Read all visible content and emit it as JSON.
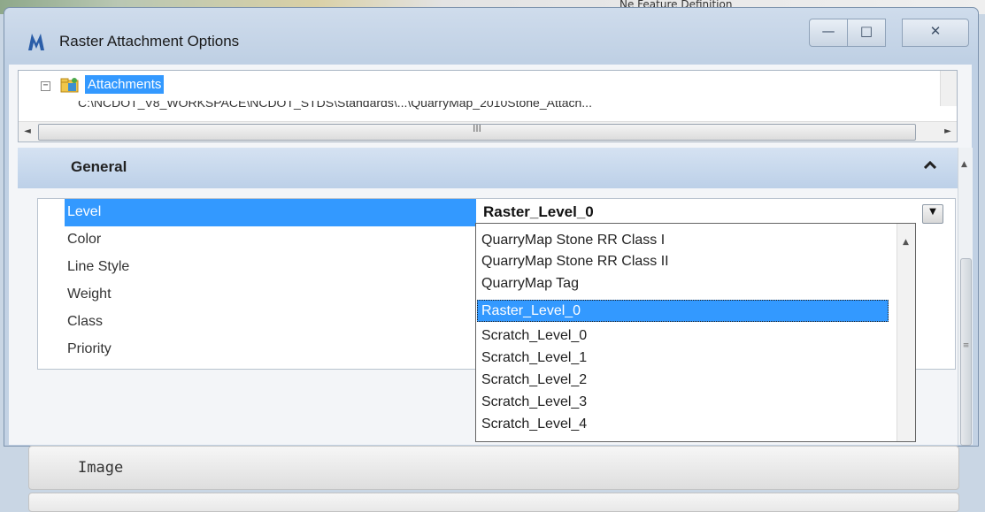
{
  "window": {
    "title": "Raster Attachment Options",
    "background_title": "Ne Feature Definition"
  },
  "caption_buttons": {
    "minimize": "—",
    "maximize": "□",
    "close": "✕"
  },
  "tree": {
    "root_label": "Attachments",
    "expander": "−",
    "child_label": "C:\\NCDOT_V8_WORKSPACE\\NCDOT_STDS\\Standards\\...\\QuarryMap_2010Stone_Attach..."
  },
  "hscroll": {
    "left_arrow": "◄",
    "right_arrow": "►",
    "grip": "III"
  },
  "general": {
    "title": "General",
    "properties": [
      {
        "name": "Level"
      },
      {
        "name": "Color"
      },
      {
        "name": "Line Style"
      },
      {
        "name": "Weight"
      },
      {
        "name": "Class"
      },
      {
        "name": "Priority"
      }
    ],
    "level_value": "Raster_Level_0",
    "combo_arrow": "▼"
  },
  "level_dropdown": {
    "items": [
      "QuarryMap Stone RR Class I",
      "QuarryMap Stone RR Class II",
      "QuarryMap Tag",
      "Raster_Level_0",
      "Scratch_Level_0",
      "Scratch_Level_1",
      "Scratch_Level_2",
      "Scratch_Level_3",
      "Scratch_Level_4"
    ],
    "selected": "Raster_Level_0",
    "scroll_up": "▲"
  },
  "image_section": {
    "title": "Image"
  },
  "scrollbar": {
    "up": "▲",
    "grip": "≡"
  },
  "colors": {
    "selection": "#3399ff",
    "section_header": "#c9dbef"
  }
}
